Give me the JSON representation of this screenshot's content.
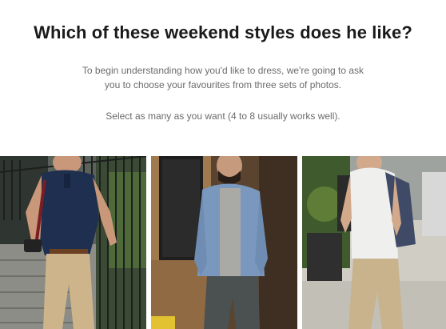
{
  "header": {
    "title": "Which of these weekend styles does he like?",
    "intro_line1": "To begin understanding how you'd like to dress, we're going to ask",
    "intro_line2": "you to choose your favourites from three sets of photos.",
    "instruction": "Select as many as you want (4 to 8 usually works well)."
  },
  "photos": [
    {
      "label": "",
      "depicts": "man in navy polo and khaki chinos walking down outdoor stairs"
    },
    {
      "label": "",
      "depicts": "bearded man in denim shirt and grey tee with dark jeans in front of storefront"
    },
    {
      "label": "",
      "depicts": "man in white t-shirt with backpack and khaki trousers walking on street"
    }
  ],
  "colors": {
    "title": "#1a1a1a",
    "subtitle": "#6b6b6b",
    "background": "#ffffff"
  }
}
